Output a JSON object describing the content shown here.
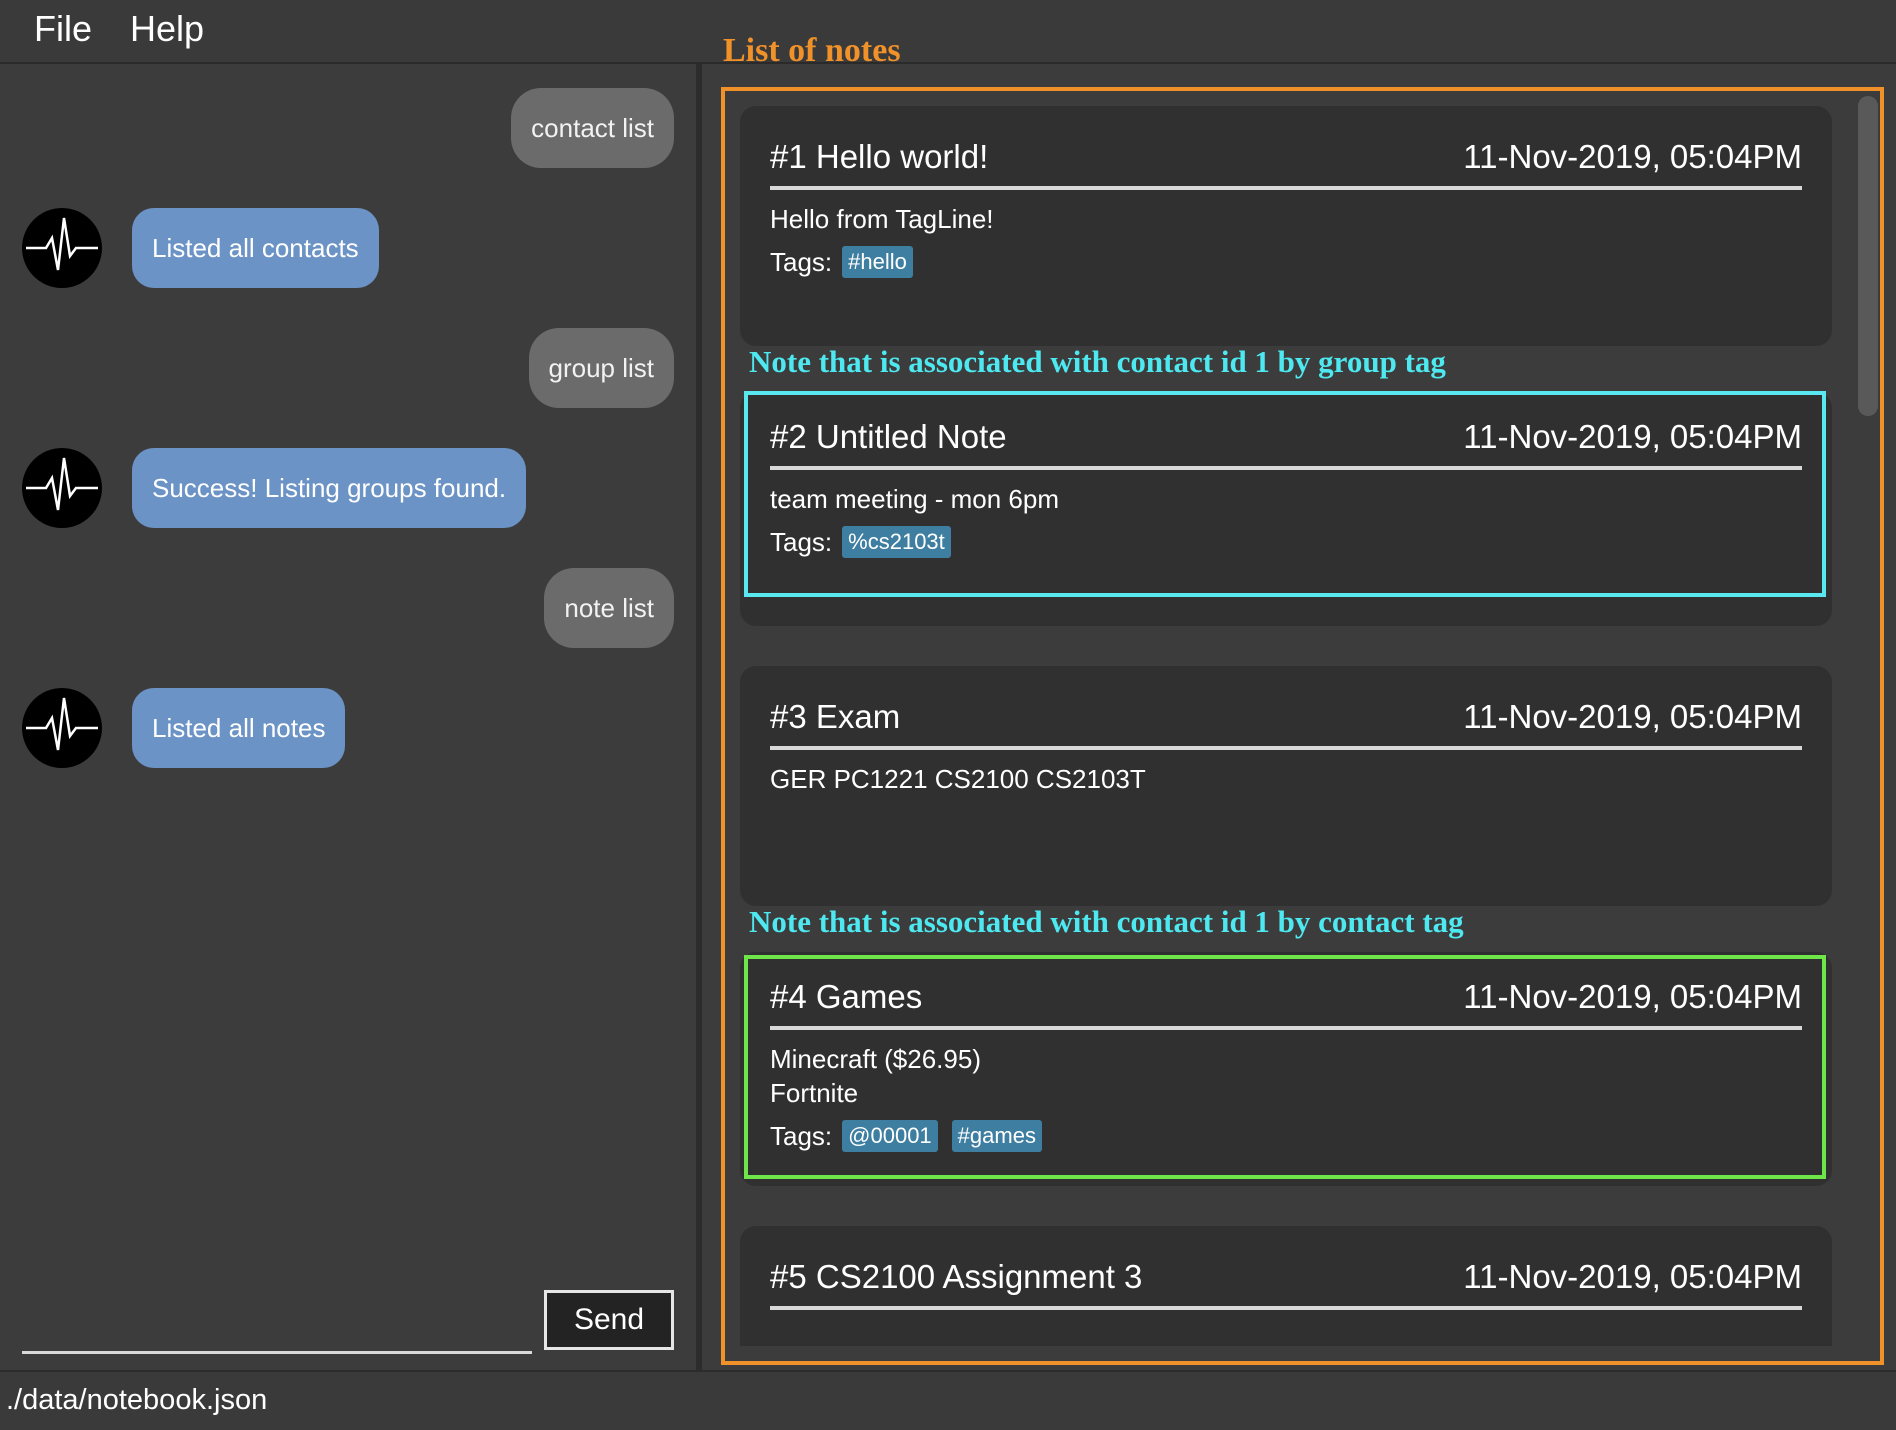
{
  "menu": {
    "file": "File",
    "help": "Help"
  },
  "chat": {
    "messages": [
      {
        "from": "user",
        "text": "contact list"
      },
      {
        "from": "bot",
        "text": "Listed all contacts"
      },
      {
        "from": "user",
        "text": "group list"
      },
      {
        "from": "bot",
        "text": "Success! Listing groups found."
      },
      {
        "from": "user",
        "text": "note list"
      },
      {
        "from": "bot",
        "text": "Listed all notes"
      }
    ],
    "input_value": "",
    "send_label": "Send",
    "avatar_icon": "heartbeat-icon"
  },
  "status": {
    "path": "./data/notebook.json"
  },
  "notes_panel": {
    "heading": "List of notes",
    "annotations": {
      "group_tag": "Note that is associated with contact id 1 by group tag",
      "contact_tag": "Note that is associated with contact id 1 by contact tag"
    },
    "tags_label": "Tags:",
    "notes": [
      {
        "title": "#1 Hello world!",
        "date": "11-Nov-2019, 05:04PM",
        "content": "Hello from TagLine!",
        "tags": [
          "#hello"
        ]
      },
      {
        "title": "#2 Untitled Note",
        "date": "11-Nov-2019, 05:04PM",
        "content": "team meeting - mon 6pm",
        "tags": [
          "%cs2103t"
        ]
      },
      {
        "title": "#3 Exam",
        "date": "11-Nov-2019, 05:04PM",
        "content": "GER PC1221 CS2100 CS2103T",
        "tags": []
      },
      {
        "title": "#4 Games",
        "date": "11-Nov-2019, 05:04PM",
        "content_lines": [
          "Minecraft ($26.95)",
          "Fortnite"
        ],
        "tags": [
          "@00001",
          "#games"
        ]
      },
      {
        "title": "#5 CS2100 Assignment 3",
        "date": "11-Nov-2019, 05:04PM",
        "content": "",
        "tags": []
      }
    ]
  },
  "colors": {
    "accent_orange": "#f0912a",
    "annotation_cyan": "#4de8f0",
    "group_highlight": "#5ae8f0",
    "contact_highlight": "#6ee64a",
    "bot_bubble": "#6b93c6",
    "user_bubble": "#6b6b6b",
    "tag_bg": "#3e7ea0"
  }
}
